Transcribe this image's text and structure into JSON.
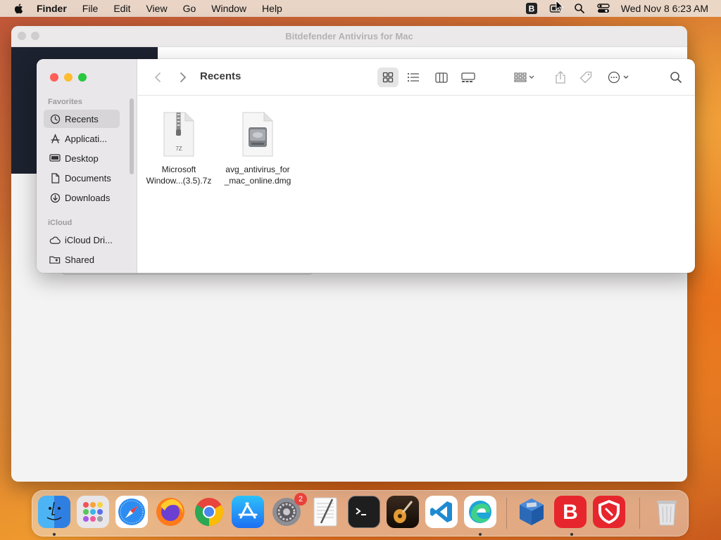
{
  "menubar": {
    "app_name": "Finder",
    "items": [
      "File",
      "Edit",
      "View",
      "Go",
      "Window",
      "Help"
    ],
    "clock": "Wed Nov 8  6:23 AM",
    "status_icons": [
      "bitdefender-icon",
      "screen-share-icon",
      "search-icon",
      "control-center-icon"
    ]
  },
  "background_window": {
    "title": "Bitdefender Antivirus for Mac"
  },
  "finder": {
    "title": "Recents",
    "sidebar": {
      "favorites_header": "Favorites",
      "favorites": [
        {
          "label": "Recents",
          "icon": "clock-icon",
          "active": true
        },
        {
          "label": "Applicati...",
          "icon": "applications-icon",
          "active": false
        },
        {
          "label": "Desktop",
          "icon": "desktop-icon",
          "active": false
        },
        {
          "label": "Documents",
          "icon": "document-icon",
          "active": false
        },
        {
          "label": "Downloads",
          "icon": "download-icon",
          "active": false
        }
      ],
      "icloud_header": "iCloud",
      "icloud": [
        {
          "label": "iCloud Dri...",
          "icon": "cloud-icon"
        },
        {
          "label": "Shared",
          "icon": "shared-folder-icon"
        }
      ]
    },
    "toolbar": {
      "view_modes": [
        "icon-view",
        "list-view",
        "column-view",
        "gallery-view"
      ],
      "selected_view": "icon-view"
    },
    "files": [
      {
        "line1": "Microsoft",
        "line2": "Window...(3.5).7z",
        "badge": "7Z",
        "type": "archive"
      },
      {
        "line1": "avg_antivirus_for",
        "line2": "_mac_online.dmg",
        "type": "disk-image"
      }
    ]
  },
  "dock": {
    "apps": [
      "Finder",
      "Launchpad",
      "Safari",
      "Firefox",
      "Chrome",
      "App Store",
      "System Settings",
      "TextEdit",
      "Terminal",
      "GarageBand",
      "Visual Studio Code",
      "Microsoft Edge",
      "VirtualBox",
      "Bitdefender",
      "Bitdefender VPN",
      "Trash"
    ],
    "settings_badge": "2"
  },
  "colors": {
    "close": "#fe5f57",
    "minimize": "#febc2e",
    "zoom": "#28c840",
    "sidebar_bg": "#e9e7ea"
  }
}
